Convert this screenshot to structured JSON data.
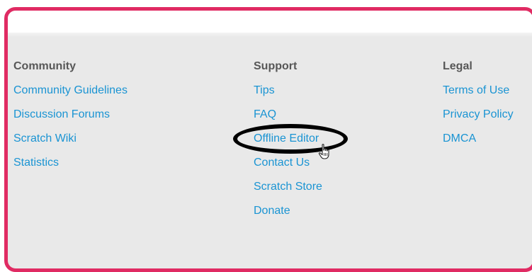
{
  "footer": {
    "columns": [
      {
        "heading": "Community",
        "links": [
          "Community Guidelines",
          "Discussion Forums",
          "Scratch Wiki",
          "Statistics"
        ]
      },
      {
        "heading": "Support",
        "links": [
          "Tips",
          "FAQ",
          "Offline Editor",
          "Contact Us",
          "Scratch Store",
          "Donate"
        ]
      },
      {
        "heading": "Legal",
        "links": [
          "Terms of Use",
          "Privacy Policy",
          "DMCA"
        ]
      }
    ]
  },
  "annotation": {
    "highlighted_link": "Offline Editor",
    "frame_color": "#e02b63",
    "ellipse_color": "#000000",
    "cursor_icon": "hand-pointer-icon"
  },
  "colors": {
    "link": "#1a94d3",
    "heading": "#575757",
    "background": "#e9e9e9"
  }
}
